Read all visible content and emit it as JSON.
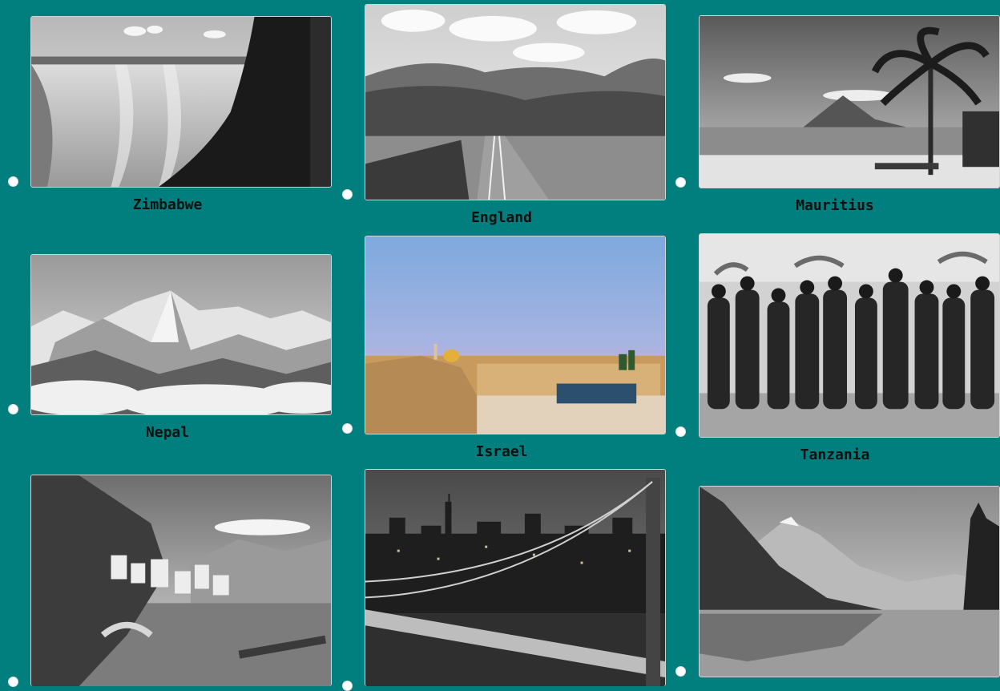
{
  "options": [
    {
      "label": "Zimbabwe"
    },
    {
      "label": "England"
    },
    {
      "label": "Mauritius"
    },
    {
      "label": "Nepal"
    },
    {
      "label": "Israel"
    },
    {
      "label": "Tanzania"
    },
    {
      "label": ""
    },
    {
      "label": ""
    },
    {
      "label": ""
    }
  ],
  "colors": {
    "background": "#007f7e",
    "radio": "#ffffff",
    "label_text": "#101010"
  }
}
